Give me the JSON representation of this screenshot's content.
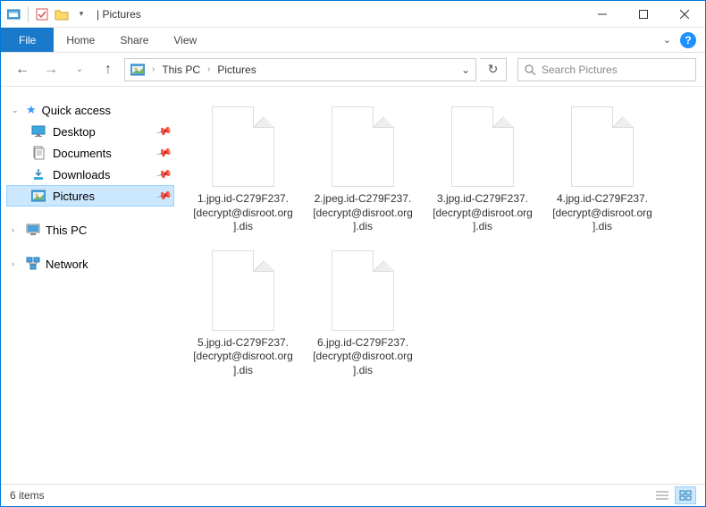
{
  "window": {
    "title": "Pictures",
    "title_prefix": "| "
  },
  "tabs": {
    "file": "File",
    "home": "Home",
    "share": "Share",
    "view": "View"
  },
  "breadcrumb": {
    "root": "This PC",
    "current": "Pictures"
  },
  "search": {
    "placeholder": "Search Pictures"
  },
  "nav": {
    "quick_access": "Quick access",
    "desktop": "Desktop",
    "documents": "Documents",
    "downloads": "Downloads",
    "pictures": "Pictures",
    "this_pc": "This PC",
    "network": "Network"
  },
  "files": [
    {
      "name": "1.jpg.id-C279F237.[decrypt@disroot.org].dis"
    },
    {
      "name": "2.jpeg.id-C279F237.[decrypt@disroot.org].dis"
    },
    {
      "name": "3.jpg.id-C279F237.[decrypt@disroot.org].dis"
    },
    {
      "name": "4.jpg.id-C279F237.[decrypt@disroot.org].dis"
    },
    {
      "name": "5.jpg.id-C279F237.[decrypt@disroot.org].dis"
    },
    {
      "name": "6.jpg.id-C279F237.[decrypt@disroot.org].dis"
    }
  ],
  "status": {
    "count": "6 items"
  }
}
